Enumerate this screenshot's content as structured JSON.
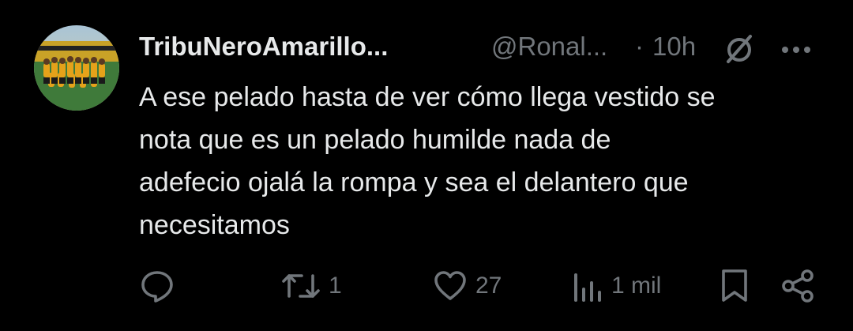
{
  "post": {
    "author": {
      "display_name": "TribuNeroAmarillo...",
      "handle": "@Ronal...",
      "separator": "·",
      "time": "10h"
    },
    "text_lines": [
      "A ese pelado hasta de ver cómo llega vestido se",
      "nota que es un pelado humilde nada de",
      "adefecio ojalá la rompa y sea el delantero que",
      "necesitamos"
    ],
    "actions": {
      "reply_count": "",
      "repost_count": "1",
      "like_count": "27",
      "views_count": "1 mil"
    },
    "icons": {
      "avatar": "team-photo-avatar",
      "grok": "grok-icon",
      "more": "more-icon",
      "reply": "reply-icon",
      "repost": "repost-icon",
      "like": "heart-icon",
      "views": "views-icon",
      "bookmark": "bookmark-icon",
      "share": "share-icon"
    },
    "colors": {
      "background": "#000000",
      "primary_text": "#e7e9ea",
      "secondary_text": "#71767b"
    }
  }
}
